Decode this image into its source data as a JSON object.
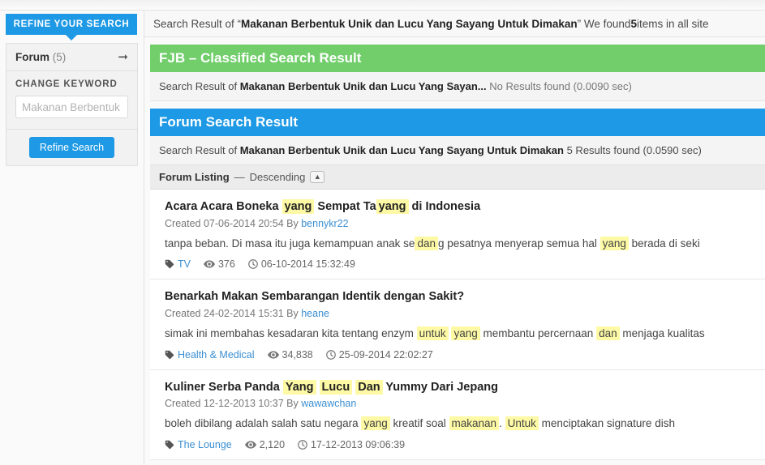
{
  "sidebar": {
    "refine_tab_label": "REFINE YOUR SEARCH",
    "filter": {
      "label": "Forum",
      "count": "(5)",
      "arrow_icon": "arrow-right-icon"
    },
    "change_keyword_label": "CHANGE KEYWORD",
    "keyword_input_value": "",
    "keyword_input_placeholder": "Makanan Berbentuk",
    "refine_button_label": "Refine Search"
  },
  "topbar": {
    "prefix": "Search Result of “",
    "query": "Makanan Berbentuk Unik dan Lucu Yang Sayang Untuk Dimakan",
    "middle": "” We found ",
    "count": "5",
    "suffix": " items in all site"
  },
  "fjb_panel": {
    "title": "FJB – Classified Search Result",
    "color": "#71ce6b",
    "sub_prefix": "Search Result of ",
    "sub_query": "Makanan Berbentuk Unik dan Lucu Yang Sayan...",
    "sub_status": "No Results found (0.0090 sec)"
  },
  "forum_panel": {
    "title": "Forum Search Result",
    "color": "#1e99e5",
    "sub_prefix": "Search Result of ",
    "sub_query": "Makanan Berbentuk Unik dan Lucu Yang Sayang Untuk Dimakan",
    "sub_status": "5 Results found (0.0590 sec)"
  },
  "listing": {
    "label": "Forum Listing",
    "separator": "—",
    "order": "Descending",
    "sort_icon": "caret-up-icon"
  },
  "results": [
    {
      "title_parts": [
        {
          "text": "Acara Acara Boneka ",
          "highlight": false
        },
        {
          "text": "yang",
          "highlight": true
        },
        {
          "text": " Sempat Ta",
          "highlight": false
        },
        {
          "text": "yang",
          "highlight": true
        },
        {
          "text": " di Indonesia",
          "highlight": false
        }
      ],
      "created_label": "Created",
      "created_date": "07-06-2014 20:54",
      "by_label": "By",
      "author": "bennykr22",
      "snippet_parts": [
        {
          "text": "tanpa beban. Di masa itu juga kemampuan anak se",
          "highlight": false
        },
        {
          "text": "dan",
          "highlight": true
        },
        {
          "text": "g pesatnya menyerap semua hal ",
          "highlight": false
        },
        {
          "text": "yang",
          "highlight": true
        },
        {
          "text": " berada di seki",
          "highlight": false
        }
      ],
      "category": "TV",
      "views": "376",
      "date": "06-10-2014 15:32:49"
    },
    {
      "title_parts": [
        {
          "text": "Benarkah Makan Sembarangan Identik dengan Sakit?",
          "highlight": false
        }
      ],
      "created_label": "Created",
      "created_date": "24-02-2014 15:31",
      "by_label": "By",
      "author": "heane",
      "snippet_parts": [
        {
          "text": "simak ini membahas kesadaran kita tentang enzym ",
          "highlight": false
        },
        {
          "text": "untuk",
          "highlight": true
        },
        {
          "text": " ",
          "highlight": false
        },
        {
          "text": "yang",
          "highlight": true
        },
        {
          "text": " membantu percernaan ",
          "highlight": false
        },
        {
          "text": "dan",
          "highlight": true
        },
        {
          "text": " menjaga kualitas",
          "highlight": false
        }
      ],
      "category": "Health & Medical",
      "views": "34,838",
      "date": "25-09-2014 22:02:27"
    },
    {
      "title_parts": [
        {
          "text": "Kuliner Serba Panda ",
          "highlight": false
        },
        {
          "text": "Yang",
          "highlight": true
        },
        {
          "text": " ",
          "highlight": false
        },
        {
          "text": "Lucu",
          "highlight": true
        },
        {
          "text": " ",
          "highlight": false
        },
        {
          "text": "Dan",
          "highlight": true
        },
        {
          "text": " Yummy Dari Jepang",
          "highlight": false
        }
      ],
      "created_label": "Created",
      "created_date": "12-12-2013 10:37",
      "by_label": "By",
      "author": "wawawchan",
      "snippet_parts": [
        {
          "text": "boleh dibilang adalah salah satu negara ",
          "highlight": false
        },
        {
          "text": "yang",
          "highlight": true
        },
        {
          "text": " kreatif soal ",
          "highlight": false
        },
        {
          "text": "makanan",
          "highlight": true
        },
        {
          "text": ". ",
          "highlight": false
        },
        {
          "text": "Untuk",
          "highlight": true
        },
        {
          "text": " menciptakan signature dish",
          "highlight": false
        }
      ],
      "category": "The Lounge",
      "views": "2,120",
      "date": "17-12-2013 09:06:39"
    }
  ],
  "icons": {
    "tag": "tag-icon",
    "eye": "eye-icon",
    "clock": "clock-icon"
  }
}
